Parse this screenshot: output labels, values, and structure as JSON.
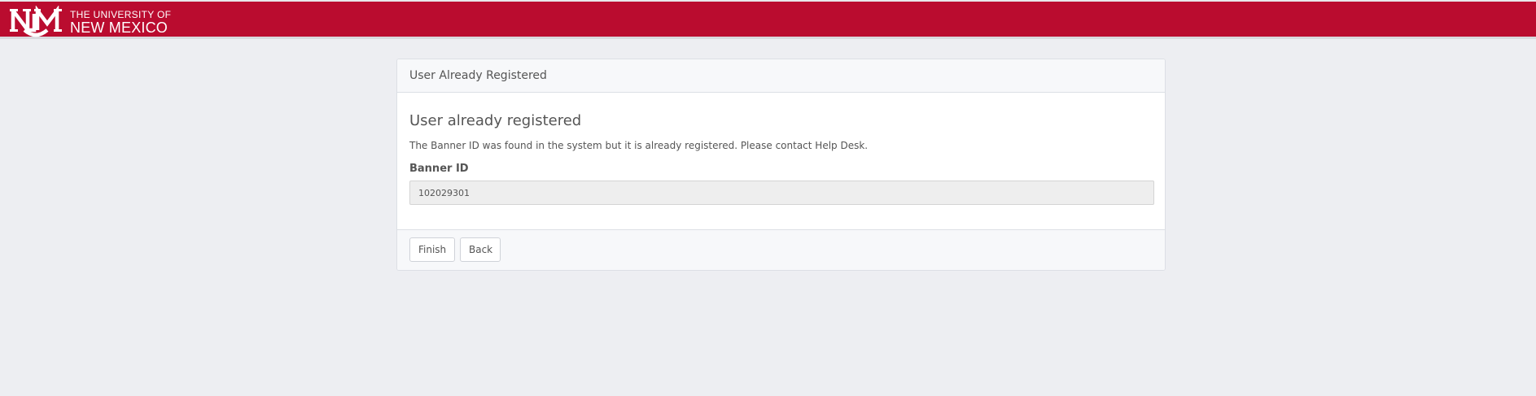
{
  "header": {
    "brand_line1": "THE UNIVERSITY OF",
    "brand_line2": "NEW MEXICO",
    "brand_color": "#ba0c2f"
  },
  "panel": {
    "heading": "User Already Registered",
    "title": "User already registered",
    "message": "The Banner ID was found in the system but it is already registered. Please contact Help Desk.",
    "field_label": "Banner ID",
    "field_value": "102029301"
  },
  "footer": {
    "finish_label": "Finish",
    "back_label": "Back"
  }
}
